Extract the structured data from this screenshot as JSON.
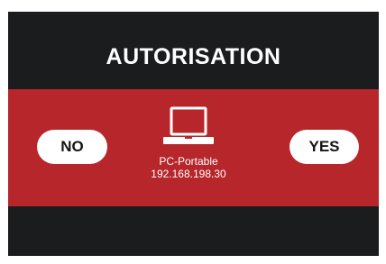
{
  "dialog": {
    "title": "AUTORISATION",
    "device": {
      "icon": "laptop-icon",
      "name": "PC-Portable",
      "ip": "192.168.198.30"
    },
    "buttons": {
      "no_label": "NO",
      "yes_label": "YES"
    }
  },
  "colors": {
    "background": "#1b1c1e",
    "band": "#b7262b",
    "button": "#ffffff",
    "button_text": "#151515"
  }
}
